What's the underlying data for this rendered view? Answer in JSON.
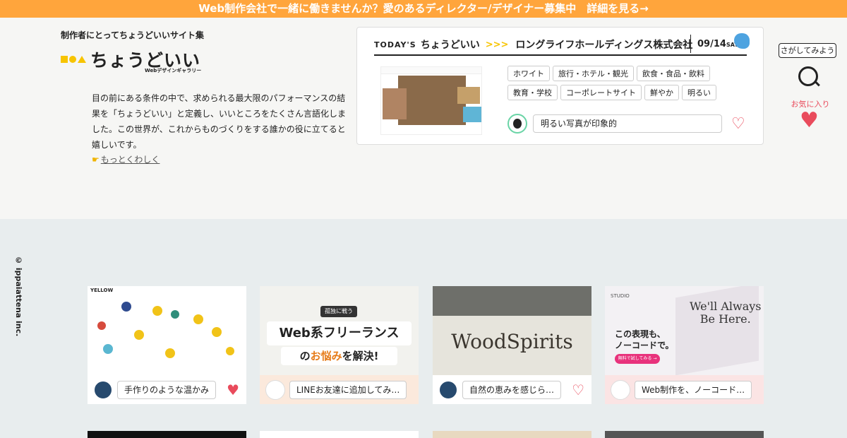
{
  "banner": {
    "text": "Web制作会社で一緒に働きませんか？愛のあるディレクター/デザイナー募集中　詳細を見る→"
  },
  "hero": {
    "tagline": "制作者にとってちょうどいいサイト集",
    "logo_text": "ちょうどいい",
    "logo_sub": "Webデザインギャラリー",
    "intro": "目の前にある条件の中で、求められる最大限のパフォーマンスの結果を「ちょうどいい」と定義し、いいところをたくさん言語化しました。この世界が、これからものづくりをする誰かの役に立てると嬉しいです。",
    "more_link": "もっとくわしく"
  },
  "today": {
    "label": "TODAY'S",
    "label2": "ちょうどいい",
    "arrows": ">>>",
    "site_name": "ロングライフホールディングス株式会社",
    "date": "09/14",
    "day": "SAT",
    "tags": [
      "ホワイト",
      "旅行・ホテル・観光",
      "飲食・食品・飲料",
      "教育・学校",
      "コーポレートサイト",
      "鮮やか",
      "明るい"
    ],
    "comment": "明るい写真が印象的"
  },
  "side": {
    "search_label": "さがしてみよう",
    "favorites_label": "お気に入り"
  },
  "credit": "© ippaiattena inc.",
  "cards": [
    {
      "comment": "手作りのような温かみ",
      "liked": true,
      "thumb_text": "YELLOW"
    },
    {
      "comment": "LINEお友達に追加してみ…",
      "liked": false,
      "thumb_top": "孤独に戦う",
      "thumb_line1": "Web系フリーランス",
      "thumb_line2a": "の",
      "thumb_line2b": "お悩み",
      "thumb_line2c": "を解決!"
    },
    {
      "comment": "自然の恵みを感じら…",
      "liked": false,
      "thumb_text": "WoodSpirits"
    },
    {
      "comment": "Web制作を、ノーコード…",
      "liked": false,
      "thumb_studio": "STUDIO",
      "thumb_phrase1": "この表現も、",
      "thumb_phrase2": "ノーコードで。",
      "thumb_btn": "無料で試してみる →",
      "thumb_big1": "We'll Always",
      "thumb_big2": "Be Here."
    }
  ],
  "colors": {
    "banner": "#ffa53c",
    "accent": "#e94b5c",
    "brand_yellow": "#f7c400"
  }
}
